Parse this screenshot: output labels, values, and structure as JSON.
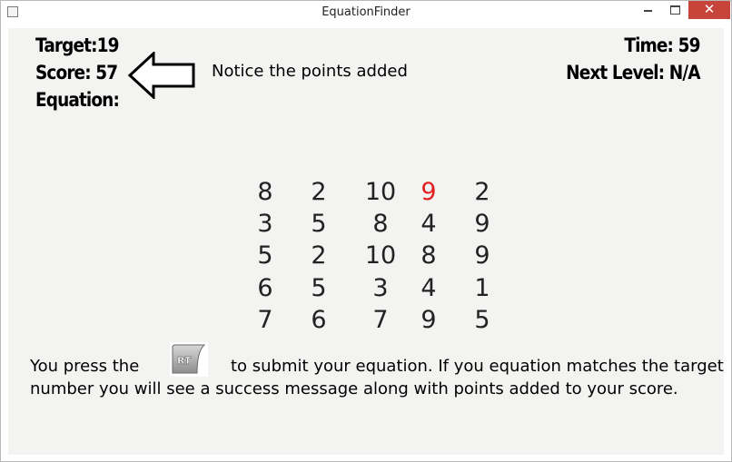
{
  "window": {
    "title": "EquationFinder",
    "minimize": "",
    "maximize": "",
    "close": "✕"
  },
  "hud": {
    "target": "Target:19",
    "score": "Score: 57",
    "equation": "Equation:",
    "time": "Time:  59",
    "next_level": "Next Level: N/A"
  },
  "note": "Notice the points added",
  "grid": {
    "rows": [
      [
        "8",
        "2",
        "10",
        "9",
        "2"
      ],
      [
        "3",
        "5",
        "8",
        "4",
        "9"
      ],
      [
        "5",
        "2",
        "10",
        "8",
        "9"
      ],
      [
        "6",
        "5",
        "3",
        "4",
        "1"
      ],
      [
        "7",
        "6",
        "7",
        "9",
        "5"
      ]
    ],
    "highlight_color": "#e02020",
    "highlighted_cell": {
      "row": 0,
      "col": 3
    }
  },
  "instructions": {
    "line1_before": "You press the",
    "line1_after": "to submit your equation.  If you equation matches the target",
    "line2": "number you will see a success message along with points added to your score.",
    "button_icon_label": "RT"
  }
}
